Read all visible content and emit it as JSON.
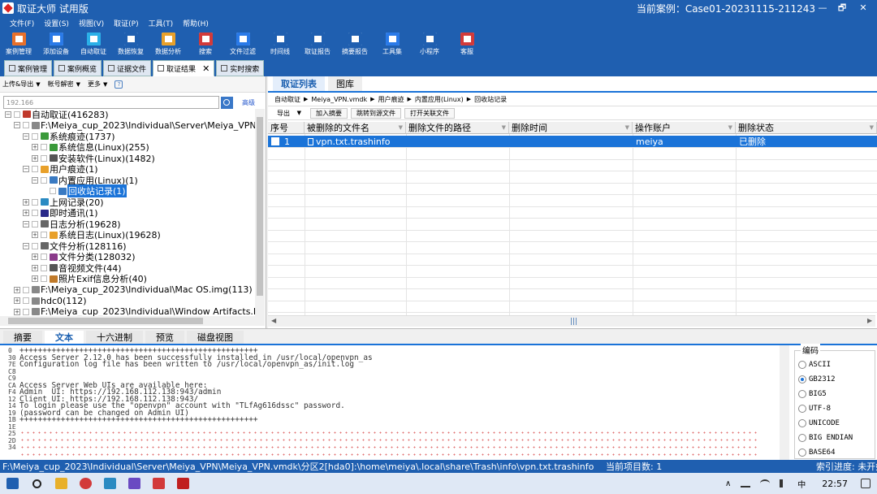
{
  "window": {
    "title": "取证大师 试用版",
    "case_label": "当前案例：Case01-20231115-211243",
    "min_label": "—",
    "restore_label": "🗗",
    "close_label": "✕"
  },
  "menu": [
    "文件(F)",
    "设置(S)",
    "视图(V)",
    "取证(P)",
    "工具(T)",
    "帮助(H)"
  ],
  "toolbar": [
    {
      "label": "案例管理",
      "icon": "case-icon",
      "color": "#e8702a"
    },
    {
      "label": "添加设备",
      "icon": "add-device-icon",
      "color": "#2a7ae8"
    },
    {
      "label": "自动取证",
      "icon": "auto-forensics-icon",
      "color": "#2ab0e8"
    },
    {
      "label": "数据恢复",
      "icon": "data-recovery-icon",
      "color": "#1f5fb0"
    },
    {
      "label": "数据分析",
      "icon": "data-analysis-icon",
      "color": "#e8a02a"
    },
    {
      "label": "搜索",
      "icon": "search-icon",
      "color": "#d23a3a"
    },
    {
      "label": "文件过滤",
      "icon": "file-filter-icon",
      "color": "#2a7ae8"
    },
    {
      "label": "时间线",
      "icon": "timeline-icon",
      "color": "#1f5fb0"
    },
    {
      "label": "取证报告",
      "icon": "report-icon",
      "color": "#1f5fb0"
    },
    {
      "label": "摘要报告",
      "icon": "summary-report-icon",
      "color": "#1f5fb0"
    },
    {
      "label": "工具集",
      "icon": "toolset-icon",
      "color": "#2a7ae8"
    },
    {
      "label": "小程序",
      "icon": "miniapp-icon",
      "color": "#1f5fb0"
    },
    {
      "label": "客服",
      "icon": "support-icon",
      "color": "#d23a3a"
    }
  ],
  "doc_tabs": [
    {
      "label": "案例管理"
    },
    {
      "label": "案例概览"
    },
    {
      "label": "证据文件"
    },
    {
      "label": "取证结果",
      "active": true,
      "close": "✕"
    },
    {
      "label": "实时搜索"
    }
  ],
  "left": {
    "tools": [
      {
        "label": "上传&导出",
        "dd": "▼"
      },
      {
        "label": "帐号解密",
        "dd": "▼"
      },
      {
        "label": "更多",
        "dd": "▼"
      }
    ],
    "help": "?",
    "search_value": "192.166",
    "advanced": "高级",
    "tree": [
      {
        "level": 0,
        "exp": "−",
        "label": "自动取证(416283)",
        "icon_color": "#c0392b"
      },
      {
        "level": 1,
        "exp": "−",
        "label": "F:\\Meiya_cup_2023\\Individual\\Server\\Meiya_VPN\\Meiy",
        "icon_color": "#888"
      },
      {
        "level": 2,
        "exp": "−",
        "label": "系统痕迹(1737)",
        "icon_color": "#3a9a3a"
      },
      {
        "level": 3,
        "exp": "+",
        "label": "系统信息(Linux)(255)",
        "icon_color": "#3a9a3a"
      },
      {
        "level": 3,
        "exp": "+",
        "label": "安装软件(Linux)(1482)",
        "icon_color": "#555"
      },
      {
        "level": 2,
        "exp": "−",
        "label": "用户痕迹(1)",
        "icon_color": "#e8a02a"
      },
      {
        "level": 3,
        "exp": "−",
        "label": "内置应用(Linux)(1)",
        "icon_color": "#3a7ac2"
      },
      {
        "level": 4,
        "exp": "",
        "label": "回收站记录(1)",
        "icon_color": "#3a7ac2",
        "selected": true
      },
      {
        "level": 2,
        "exp": "+",
        "label": "上网记录(20)",
        "icon_color": "#2a8ac2"
      },
      {
        "level": 2,
        "exp": "+",
        "label": "即时通讯(1)",
        "icon_color": "#2a2a8a"
      },
      {
        "level": 2,
        "exp": "−",
        "label": "日志分析(19628)",
        "icon_color": "#666"
      },
      {
        "level": 3,
        "exp": "+",
        "label": "系统日志(Linux)(19628)",
        "icon_color": "#e8a02a"
      },
      {
        "level": 2,
        "exp": "−",
        "label": "文件分析(128116)",
        "icon_color": "#666"
      },
      {
        "level": 3,
        "exp": "+",
        "label": "文件分类(128032)",
        "icon_color": "#8a3a8a"
      },
      {
        "level": 3,
        "exp": "+",
        "label": "音视频文件(44)",
        "icon_color": "#555"
      },
      {
        "level": 3,
        "exp": "+",
        "label": "照片Exif信息分析(40)",
        "icon_color": "#c07a2a"
      },
      {
        "level": 1,
        "exp": "+",
        "label": "F:\\Meiya_cup_2023\\Individual\\Mac OS.img(113)",
        "icon_color": "#888"
      },
      {
        "level": 1,
        "exp": "+",
        "label": "hdc0(112)",
        "icon_color": "#888"
      },
      {
        "level": 1,
        "exp": "+",
        "label": "F:\\Meiya_cup_2023\\Individual\\Window Artifacts.E01(26",
        "icon_color": "#888"
      }
    ]
  },
  "right": {
    "tabs": [
      "取证列表",
      "图库"
    ],
    "breadcrumb": [
      "自动取证",
      "Meiya_VPN.vmdk",
      "用户痕迹",
      "内置应用(Linux)",
      "回收站记录"
    ],
    "crumb_sep": "▶",
    "actions": {
      "export": "导出",
      "export_dd": "▼",
      "add_summary": "加入摘要",
      "jump_source": "跳转到源文件",
      "open_related": "打开关联文件"
    },
    "columns": [
      "序号",
      "被删除的文件名",
      "删除文件的路径",
      "删除时间",
      "操作账户",
      "删除状态"
    ],
    "sort_glyph": "▼",
    "rows": [
      {
        "no": "1",
        "name": "vpn.txt.trashinfo",
        "path": "",
        "time": "",
        "account": "meiya",
        "status": "已删除"
      }
    ],
    "hscroll": {
      "left": "◀",
      "right": "▶",
      "grip": "|||"
    }
  },
  "bottom": {
    "tabs": [
      "摘要",
      "文本",
      "十六进制",
      "预览",
      "磁盘视图"
    ],
    "active_tab": "文本",
    "offsets": [
      "0",
      "30",
      "7E",
      "C8",
      "C9",
      "CA",
      "F4",
      "12",
      "14",
      "19",
      "1B",
      "1E",
      "25",
      "2D",
      "34"
    ],
    "lines": [
      "++++++++++++++++++++++++++++++++++++++++++++++++++++",
      "Access Server 2.12.0 has been successfully installed in /usr/local/openvpn_as",
      "Configuration log file has been written to /usr/local/openvpn_as/init.log",
      "",
      "",
      "Access Server Web UIs are available here:",
      "Admin  UI: https://192.168.112.138:943/admin",
      "Client UI: https://192.168.112.138:943/",
      "To login please use the \"openvpn\" account with \"TLfAg616dssc\" password.",
      "(password can be changed on Admin UI)",
      "++++++++++++++++++++++++++++++++++++++++++++++++++++"
    ],
    "encoding": {
      "title": "编码",
      "options": [
        "ASCII",
        "GB2312",
        "BIG5",
        "UTF-8",
        "UNICODE",
        "BIG ENDIAN",
        "BASE64"
      ],
      "selected": "GB2312"
    }
  },
  "status": {
    "path": "F:\\Meiya_cup_2023\\Individual\\Server\\Meiya_VPN\\Meiya_VPN.vmdk\\分区2[hda0]:\\home\\meiya\\.local\\share\\Trash\\info\\vpn.txt.trashinfo",
    "count": "当前项目数: 1",
    "progress": "索引进度: 未开始"
  },
  "taskbar": {
    "apps": [
      {
        "icon": "windows-start-icon",
        "color": "#1f5fb0"
      },
      {
        "icon": "search-icon",
        "color": "#222"
      },
      {
        "icon": "file-explorer-icon",
        "color": "#e8b02a"
      },
      {
        "icon": "chrome-icon",
        "color": "#d23a3a"
      },
      {
        "icon": "app-icon",
        "color": "#2a8ac2"
      },
      {
        "icon": "app-icon",
        "color": "#6a4ac2"
      },
      {
        "icon": "wps-icon",
        "color": "#d23a3a"
      },
      {
        "icon": "forensics-app-icon",
        "color": "#c02020"
      }
    ],
    "tray_chevron": "∧",
    "ime": "中",
    "clock": "22:57"
  }
}
